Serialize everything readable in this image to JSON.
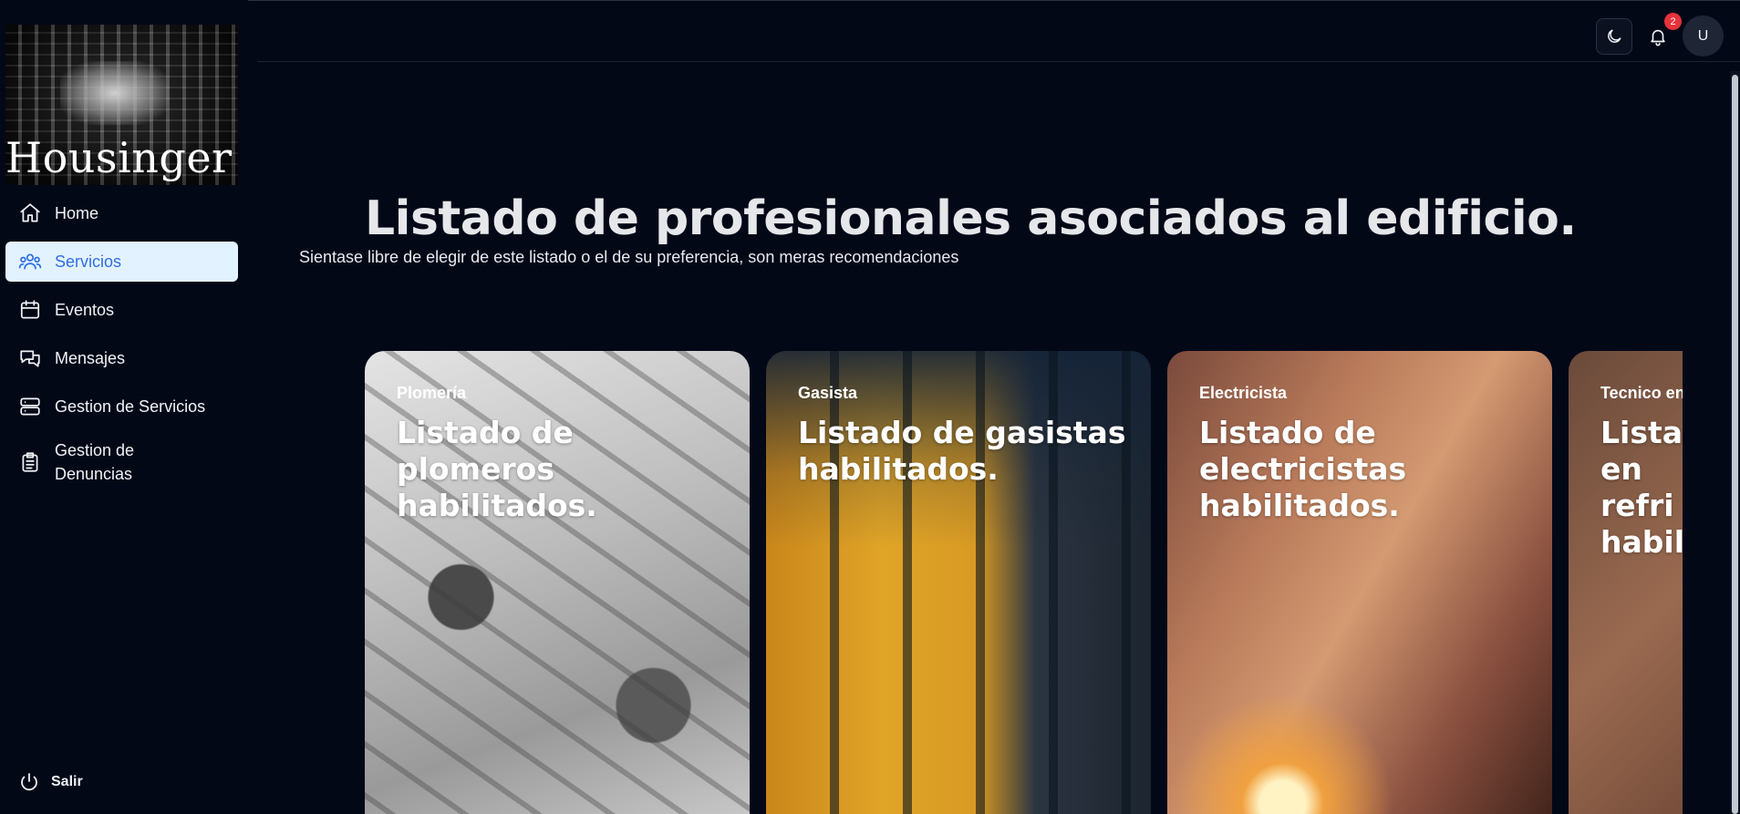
{
  "brand": {
    "name": "Housinger"
  },
  "sidebar": {
    "items": [
      {
        "label": "Home",
        "icon": "home-icon"
      },
      {
        "label": "Servicios",
        "icon": "users-icon",
        "active": true
      },
      {
        "label": "Eventos",
        "icon": "calendar-icon"
      },
      {
        "label": "Mensajes",
        "icon": "messages-icon"
      },
      {
        "label": "Gestion de Servicios",
        "icon": "server-icon"
      },
      {
        "label_line1": "Gestion de",
        "label_line2": "Denuncias",
        "icon": "clipboard-icon"
      }
    ],
    "logout_label": "Salir"
  },
  "topbar": {
    "notification_count": "2",
    "avatar_initial": "U"
  },
  "main": {
    "title": "Listado de profesionales asociados al edificio.",
    "subtitle": "Sientase libre de elegir de este listado o el de su preferencia, son meras recomendaciones",
    "cards": [
      {
        "category": "Plomería",
        "title": "Listado de plomeros habilitados."
      },
      {
        "category": "Gasista",
        "title": "Listado de gasistas habilitados."
      },
      {
        "category": "Electricista",
        "title": "Listado de electricistas habilitados."
      },
      {
        "category": "Tecnico en",
        "title": "Listado en refri habilitados."
      }
    ]
  },
  "colors": {
    "background": "#030817",
    "active_nav_bg": "#e3f2ff",
    "active_nav_text": "#2f6fe3",
    "badge": "#e5333b"
  }
}
